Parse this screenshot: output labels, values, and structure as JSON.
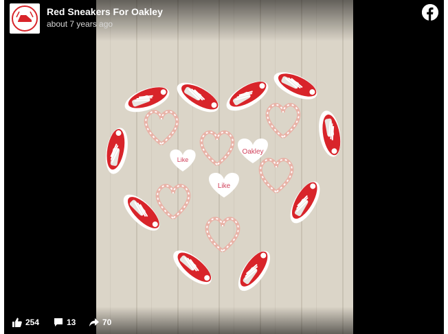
{
  "post": {
    "page_name": "Red Sneakers For Oakley",
    "timestamp": "about 7 years ago"
  },
  "photo": {
    "heart_labels": [
      "Oakley",
      "Like",
      "Like"
    ],
    "colors": {
      "sneaker": "#d8242a",
      "floor": "#d9d3c6",
      "candy_cane": "#e9b2a7"
    }
  },
  "stats": {
    "likes": "254",
    "comments": "13",
    "shares": "70"
  },
  "icons": [
    "facebook-logo-icon",
    "like-icon",
    "comment-icon",
    "share-icon"
  ],
  "colors": {
    "background": "#000000",
    "text": "#ffffff",
    "subtext": "#d8d8d8"
  }
}
